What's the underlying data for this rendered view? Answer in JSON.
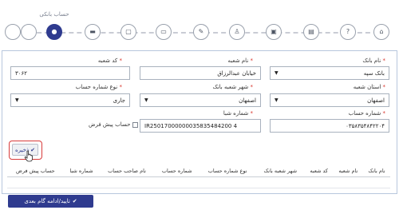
{
  "wizard": {
    "active_title": "حساب بانکی",
    "steps": [
      {
        "name": "step-home-icon",
        "glyph": "⌂"
      },
      {
        "name": "step-question-icon",
        "glyph": "?"
      },
      {
        "name": "step-doc-icon",
        "glyph": "▤"
      },
      {
        "name": "step-card-icon",
        "glyph": "▣"
      },
      {
        "name": "step-person-icon",
        "glyph": "♙"
      },
      {
        "name": "step-education-icon",
        "glyph": "✎"
      },
      {
        "name": "step-briefcase-icon",
        "glyph": "▭"
      },
      {
        "name": "step-monitor-icon",
        "glyph": "▢"
      },
      {
        "name": "step-bank-card-icon",
        "glyph": "▬"
      },
      {
        "name": "step-person2-icon",
        "glyph": "●"
      },
      {
        "name": "step-empty-1",
        "glyph": ""
      },
      {
        "name": "step-empty-2",
        "glyph": ""
      }
    ]
  },
  "form": {
    "bank_name": {
      "label": "نام بانک",
      "value": "بانک سپه"
    },
    "branch_name": {
      "label": "نام شعبه",
      "value": "خیابان عبدالرزاق"
    },
    "branch_code": {
      "label": "کد شعبه",
      "value": "۳۰۶۲"
    },
    "province": {
      "label": "استان شعبه",
      "value": "اصفهان"
    },
    "city": {
      "label": "شهر شعبه بانک",
      "value": "اصفهان"
    },
    "account_type": {
      "label": "نوع شماره حساب",
      "value": "جاری"
    },
    "account_number": {
      "label": "شماره حساب",
      "value": "۰۳۵۸۳۵۴۸۴۲۲۰۴"
    },
    "sheba": {
      "label": "شماره شبا",
      "value": "IR25017000000035835484200 4"
    },
    "default_account": {
      "label": "حساب پیش فرض"
    },
    "save_label": "ذخیره"
  },
  "table": {
    "columns": [
      "نام بانک",
      "نام شعبه",
      "کد شعبه",
      "شهر شعبه بانک",
      "نوع شماره حساب",
      "شماره حساب",
      "نام صاحب حساب",
      "شماره شبا",
      "حساب پیش فرض"
    ]
  },
  "next_label": "تایید/ادامه گام بعدی"
}
